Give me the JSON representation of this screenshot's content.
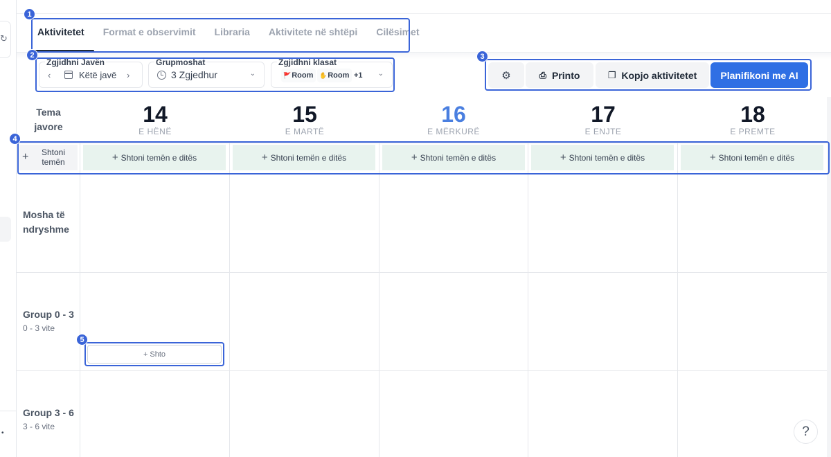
{
  "tabs": [
    {
      "label": "Aktivitetet",
      "active": true
    },
    {
      "label": "Format e observimit",
      "active": false
    },
    {
      "label": "Libraria",
      "active": false
    },
    {
      "label": "Aktivitete në shtëpi",
      "active": false
    },
    {
      "label": "Cilësimet",
      "active": false
    }
  ],
  "filters": {
    "week": {
      "label": "Zgjidhni Javën",
      "value": "Këtë javë"
    },
    "age_groups": {
      "label": "Grupmoshat",
      "value": "3 Zgjedhur"
    },
    "classes": {
      "label": "Zgjidhni klasat",
      "chips": [
        "Room",
        "Room"
      ],
      "more": "+1"
    }
  },
  "toolbar": {
    "print_label": "Printo",
    "copy_label": "Kopjo aktivitetet",
    "ai_label": "Planifikoni me AI",
    "ai_color": "#2f6fe4"
  },
  "annotations": [
    "1",
    "2",
    "3",
    "4",
    "5"
  ],
  "week_theme_label": "Tema javore",
  "days": [
    {
      "num": "14",
      "name": "E HËNË",
      "today": false
    },
    {
      "num": "15",
      "name": "E MARTË",
      "today": false
    },
    {
      "num": "16",
      "name": "E MËRKURË",
      "today": true
    },
    {
      "num": "17",
      "name": "E ENJTE",
      "today": false
    },
    {
      "num": "18",
      "name": "E PREMTE",
      "today": false
    }
  ],
  "add_week_theme_label": "Shtoni temën",
  "add_day_theme_label": "Shtoni temën e ditës",
  "rows": [
    {
      "label": "Mosha të ndryshme",
      "sub": ""
    },
    {
      "label": "Group 0 - 3",
      "sub": "0 - 3 vite"
    },
    {
      "label": "Group 3 - 6",
      "sub": "3 - 6 vite"
    }
  ],
  "add_activity_label": "+ Shto",
  "help_label": "?",
  "colors": {
    "accent": "#3a64d8",
    "today": "#4a7fe0",
    "theme_cell": "#e8f3ee"
  }
}
